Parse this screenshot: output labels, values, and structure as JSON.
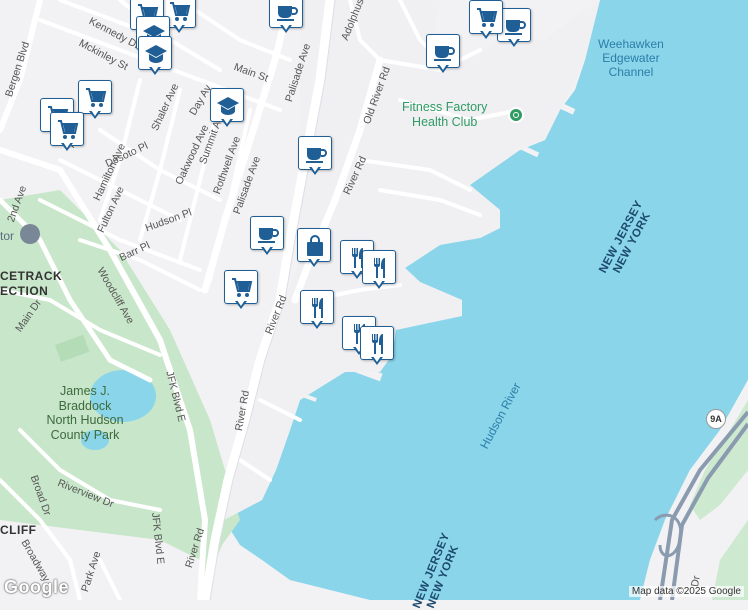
{
  "map": {
    "water_color": "#8ad5ea",
    "land_color": "#f2f2f4",
    "park_color": "#c8e6c9",
    "road_color": "#ffffff",
    "major_road_color": "#d9dde3",
    "highway_color": "#8a9bb0"
  },
  "labels": {
    "water": {
      "channel_line1": "Weehawken",
      "channel_line2": "Edgewater",
      "channel_line3": "Channel",
      "river": "Hudson River"
    },
    "states": {
      "nj_upper": "NEW JERSEY",
      "ny_upper": "NEW YORK",
      "nj_lower": "NEW JERSEY",
      "ny_lower": "NEW YORK"
    },
    "park": {
      "line1": "James J.",
      "line2": "Braddock",
      "line3": "North Hudson",
      "line4": "County Park"
    },
    "poi": {
      "line1": "Fitness Factory",
      "line2": "Health Club"
    },
    "neighborhood": {
      "line1": "CETRACK",
      "line2": "ECTION"
    },
    "cut_text": {
      "tor": "tor",
      "cliff": "CLIFF"
    },
    "roads": {
      "bergen_blvd": "Bergen Blvd",
      "kennedy_dr": "Kennedy Dr",
      "mckinley_st": "Mckinley St",
      "main_st": "Main St",
      "palisade_ave_top": "Palisade Ave",
      "adolphus": "Adolphus",
      "old_river_rd": "Old River Rd",
      "river_rd_top": "River Rd",
      "shaler_ave": "Shaler Ave",
      "day_av": "Day Av",
      "anderson": "Anderson",
      "hamilton_ave": "Hamilton Ave",
      "desoto_pl": "Desoto Pl",
      "oakwood_ave": "Oakwood Ave",
      "summit_ave": "Summit Ave",
      "rothwell_ave": "Rothwell Ave",
      "palisade_ave_mid": "Palisade Ave",
      "second_ave": "2nd Ave",
      "fulton_ave": "Fulton Ave",
      "hudson_pl": "Hudson Pl",
      "barr_pl": "Barr Pl",
      "woodcliff_ave": "Woodcliff Ave",
      "main_dr": "Main Dr",
      "jfk_blvd_e_upper": "JFK Blvd E",
      "river_rd_mid": "River Rd",
      "river_rd_low": "River Rd",
      "riverview_dr": "Riverview Dr",
      "broad_dr": "Broad Dr",
      "jfk_blvd_e_lower": "JFK Blvd E",
      "broadway": "Broadway",
      "park_ave": "Park Ave",
      "river_rd_bottom": "River Rd",
      "dr_cut": "Dr"
    },
    "highway_shield": "9A"
  },
  "markers": [
    {
      "type": "cafe-icon"
    },
    {
      "type": "shopping-cart-icon"
    },
    {
      "type": "shopping-cart-icon"
    },
    {
      "type": "education-icon"
    },
    {
      "type": "education-icon"
    },
    {
      "type": "cafe-icon"
    },
    {
      "type": "shopping-cart-icon"
    },
    {
      "type": "cafe-icon"
    },
    {
      "type": "shopping-cart-icon"
    },
    {
      "type": "shopping-cart-icon"
    },
    {
      "type": "shopping-cart-icon"
    },
    {
      "type": "education-icon"
    },
    {
      "type": "cafe-icon"
    },
    {
      "type": "cafe-icon"
    },
    {
      "type": "shopping-bag-icon"
    },
    {
      "type": "restaurant-icon"
    },
    {
      "type": "restaurant-icon"
    },
    {
      "type": "shopping-cart-icon"
    },
    {
      "type": "restaurant-icon"
    },
    {
      "type": "restaurant-icon"
    },
    {
      "type": "restaurant-icon"
    }
  ],
  "footer": {
    "logo": "Google",
    "attribution": "Map data ©2025 Google"
  }
}
